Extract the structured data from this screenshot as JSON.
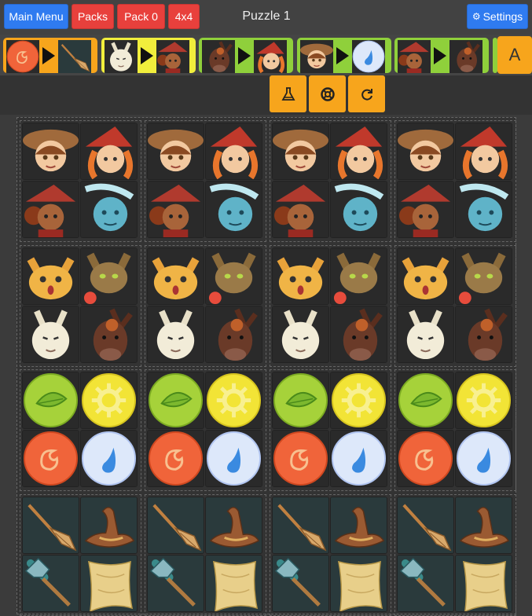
{
  "header": {
    "main_menu": "Main Menu",
    "packs": "Packs",
    "pack": "Pack 0",
    "size": "4x4",
    "title": "Puzzle 1",
    "settings": "Settings"
  },
  "hints": [
    {
      "from": "fire",
      "to": "broom",
      "color": "#f7a51c"
    },
    {
      "from": "goat",
      "to": "witch-dark",
      "color": "#f1ee3c"
    },
    {
      "from": "donkey",
      "to": "witch-red",
      "color": "#8fd03b"
    },
    {
      "from": "girl",
      "to": "water",
      "color": "#8fd03b"
    },
    {
      "from": "witch-dark",
      "to": "donkey",
      "color": "#8fd03b"
    }
  ],
  "hint_more_label": "A",
  "tools": [
    "flask-icon",
    "lifebuoy-icon",
    "refresh-icon"
  ],
  "colors": {
    "accent_orange": "#f7a51c",
    "blue": "#2f7bf0",
    "red": "#e8403c",
    "board_bg": "#333333"
  },
  "board": {
    "rows": [
      [
        "girl",
        "witch-red",
        "witch-dark",
        "elf-blue"
      ],
      [
        "cat-orange",
        "cat-brown",
        "goat",
        "donkey"
      ],
      [
        "leaf",
        "gear",
        "fire",
        "water"
      ],
      [
        "broom",
        "hat",
        "shovel",
        "cloth"
      ]
    ]
  }
}
